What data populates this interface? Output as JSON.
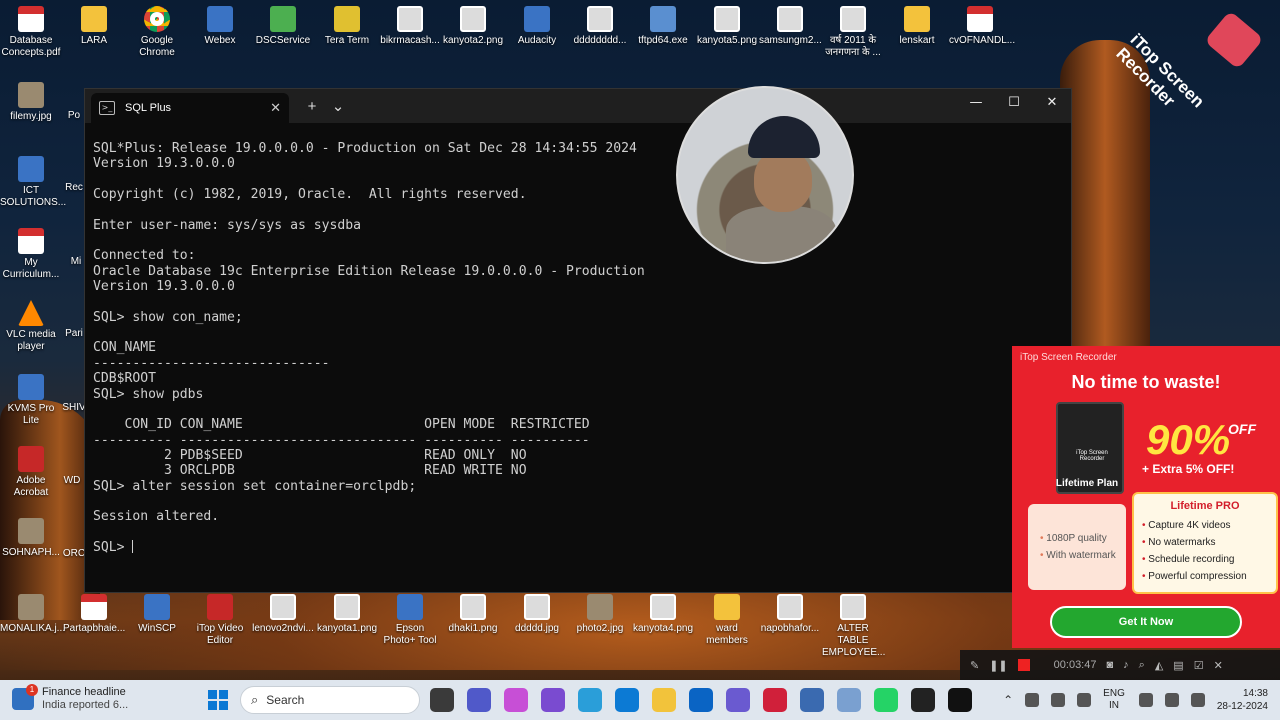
{
  "desktop": {
    "top_row": [
      {
        "label": "Database Concepts.pdf",
        "icon": "pdf-icon"
      },
      {
        "label": "LARA",
        "icon": "folder-icon"
      },
      {
        "label": "Google Chrome",
        "icon": "chrome-icon"
      },
      {
        "label": "Webex",
        "icon": "webex-icon"
      },
      {
        "label": "DSCService",
        "icon": "dsc-icon"
      },
      {
        "label": "Tera Term",
        "icon": "teraterm-icon"
      },
      {
        "label": "bikrmacash...",
        "icon": "image-icon"
      },
      {
        "label": "kanyota2.png",
        "icon": "image-icon"
      },
      {
        "label": "Audacity",
        "icon": "audacity-icon"
      },
      {
        "label": "dddddddd...",
        "icon": "image-icon"
      },
      {
        "label": "tftpd64.exe",
        "icon": "exe-icon"
      },
      {
        "label": "kanyota5.png",
        "icon": "image-icon"
      },
      {
        "label": "samsungm2...",
        "icon": "image-icon"
      },
      {
        "label": "वर्ष 2011 के जनगणना के ...",
        "icon": "image-icon"
      },
      {
        "label": "lenskart",
        "icon": "folder-icon"
      },
      {
        "label": "cvOFNANDL...",
        "icon": "pdf-icon"
      }
    ],
    "left_col": [
      {
        "label": "filemy.jpg",
        "icon": "photo-icon"
      },
      {
        "label": "ICT SOLUTIONS...",
        "icon": "app-icon"
      },
      {
        "label": "My Curriculum...",
        "icon": "pdf-icon"
      },
      {
        "label": "VLC media player",
        "icon": "vlc-icon"
      },
      {
        "label": "KVMS Pro Lite",
        "icon": "kvms-icon"
      },
      {
        "label": "Adobe Acrobat",
        "icon": "acrobat-icon"
      },
      {
        "label": "SOHNAPH...",
        "icon": "photo-icon"
      }
    ],
    "left_col2": [
      {
        "label": "Po"
      },
      {
        "label": "Rec"
      },
      {
        "label": "Mi"
      },
      {
        "label": "Pari"
      },
      {
        "label": "SHIV"
      },
      {
        "label": "WD"
      },
      {
        "label": "ORC"
      }
    ],
    "bottom_row": [
      {
        "label": "MONALIKA.j...",
        "icon": "photo-icon"
      },
      {
        "label": "Partapbhaie...",
        "icon": "pdf-icon"
      },
      {
        "label": "WinSCP",
        "icon": "winscp-icon"
      },
      {
        "label": "iTop Video Editor",
        "icon": "itop-icon"
      },
      {
        "label": "lenovo2ndvi...",
        "icon": "file-icon"
      },
      {
        "label": "kanyota1.png",
        "icon": "image-icon"
      },
      {
        "label": "Epson Photo+ Tool",
        "icon": "epson-icon"
      },
      {
        "label": "dhaki1.png",
        "icon": "image-icon"
      },
      {
        "label": "ddddd.jpg",
        "icon": "image-icon"
      },
      {
        "label": "photo2.jpg",
        "icon": "photo-icon"
      },
      {
        "label": "kanyota4.png",
        "icon": "image-icon"
      },
      {
        "label": "ward members",
        "icon": "folder-icon"
      },
      {
        "label": "napobhafor...",
        "icon": "file-icon"
      },
      {
        "label": "ALTER TABLE EMPLOYEE...",
        "icon": "file-icon"
      }
    ]
  },
  "terminal": {
    "tab_title": "SQL Plus",
    "tab_icon": "terminal-icon",
    "new_tab": "+",
    "dropdown": "⌄",
    "minimize": "—",
    "maximize": "☐",
    "close": "✕",
    "lines": [
      "SQL*Plus: Release 19.0.0.0.0 - Production on Sat Dec 28 14:34:55 2024",
      "Version 19.3.0.0.0",
      "",
      "Copyright (c) 1982, 2019, Oracle.  All rights reserved.",
      "",
      "Enter user-name: sys/sys as sysdba",
      "",
      "Connected to:",
      "Oracle Database 19c Enterprise Edition Release 19.0.0.0.0 - Production",
      "Version 19.3.0.0.0",
      "",
      "SQL> show con_name;",
      "",
      "CON_NAME",
      "------------------------------",
      "CDB$ROOT",
      "SQL> show pdbs",
      "",
      "    CON_ID CON_NAME                       OPEN MODE  RESTRICTED",
      "---------- ------------------------------ ---------- ----------",
      "         2 PDB$SEED                       READ ONLY  NO",
      "         3 ORCLPDB                        READ WRITE NO",
      "SQL> alter session set container=orclpdb;",
      "",
      "Session altered.",
      ""
    ],
    "prompt": "SQL> "
  },
  "recorder": {
    "watermark": "iTop Screen Recorder",
    "elapsed": "00:03:47"
  },
  "promo": {
    "brand": "iTop Screen Recorder",
    "headline": "No time to waste!",
    "box_name": "iTop Screen Recorder",
    "plan": "Lifetime Plan",
    "discount": "90%",
    "off": "OFF",
    "extra": "+ Extra 5% OFF!",
    "free_features": [
      "1080P quality",
      "With watermark"
    ],
    "pro_title": "Lifetime PRO",
    "pro_features": [
      "Capture 4K videos",
      "No watermarks",
      "Schedule recording",
      "Powerful compression"
    ],
    "cta": "Get It Now"
  },
  "taskbar": {
    "news_title": "Finance headline",
    "news_sub": "India reported 6...",
    "news_count": "1",
    "search_placeholder": "Search",
    "lang_top": "ENG",
    "lang_bottom": "IN",
    "time": "14:38",
    "date": "28-12-2024"
  },
  "colors": {
    "terminal_bg": "#0c0c0c",
    "terminal_fg": "#d0d0d0",
    "promo_bg": "#e8212c",
    "promo_accent": "#ffe641",
    "cta_green": "#23a72f"
  }
}
